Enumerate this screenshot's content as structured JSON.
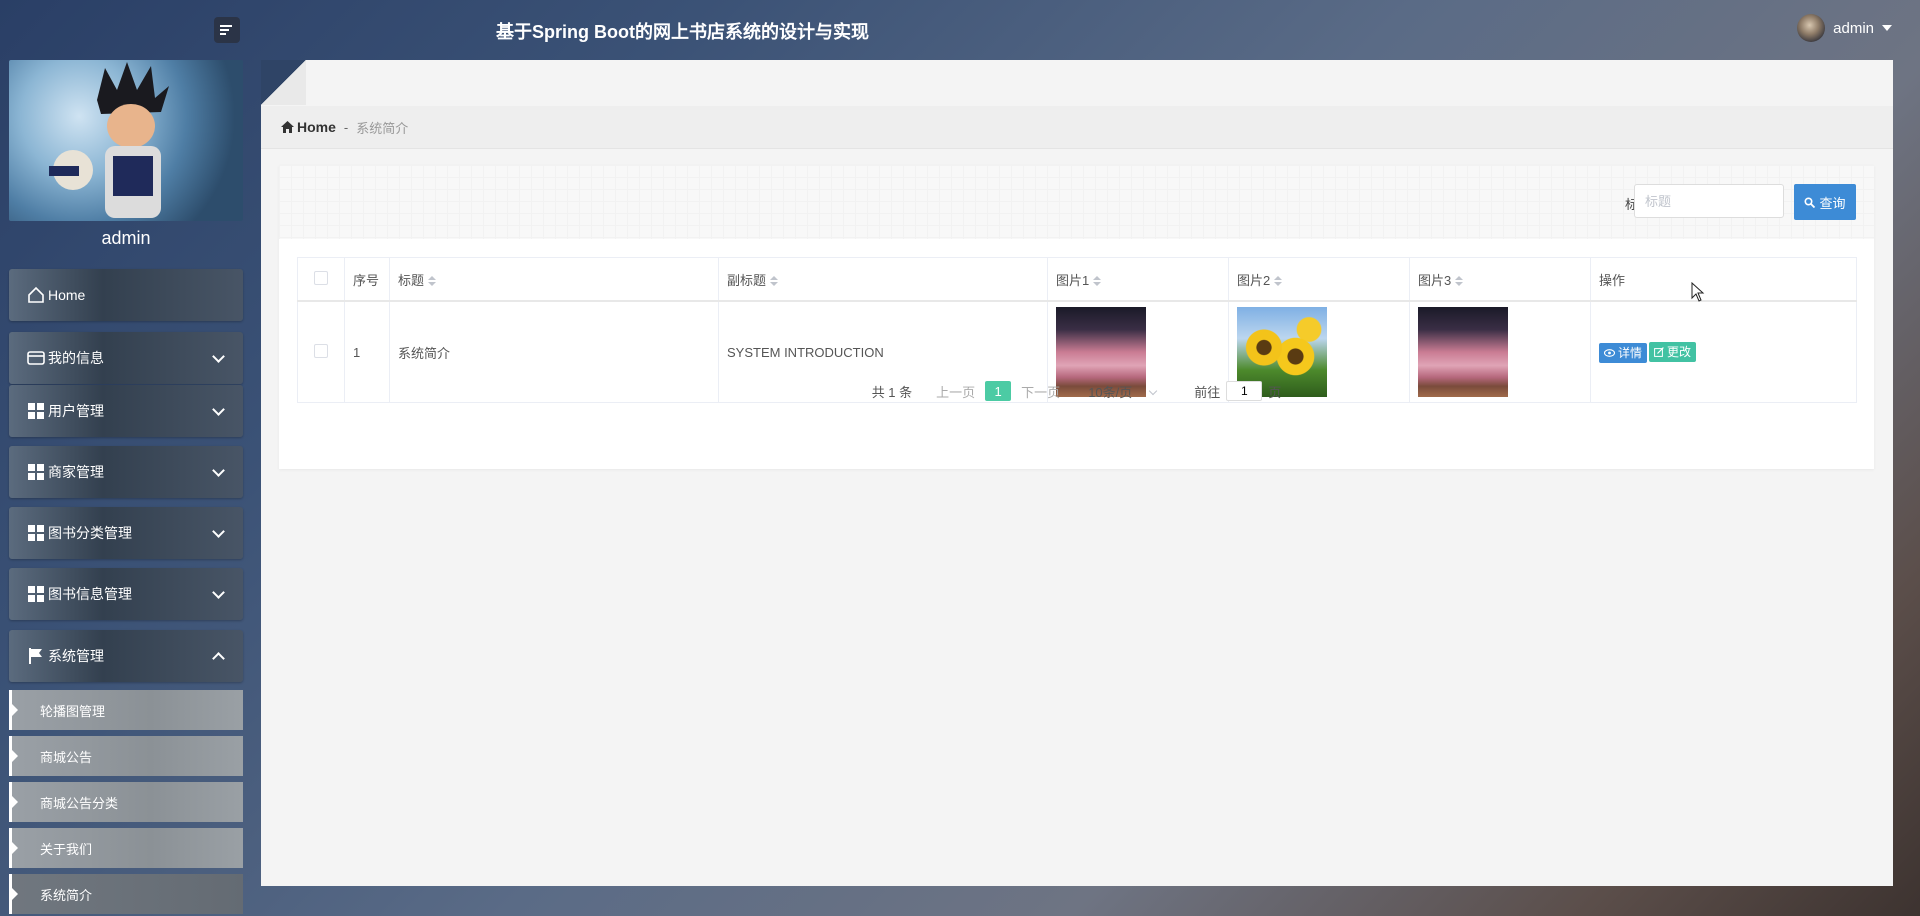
{
  "header": {
    "title": "基于Spring Boot的网上书店系统的设计与实现",
    "username": "admin"
  },
  "sidebar": {
    "profile_name": "admin",
    "items": [
      {
        "label": "Home",
        "icon": "home-icon"
      },
      {
        "label": "我的信息",
        "icon": "wallet-icon"
      },
      {
        "label": "用户管理",
        "icon": "grid-icon"
      },
      {
        "label": "商家管理",
        "icon": "grid-icon"
      },
      {
        "label": "图书分类管理",
        "icon": "grid-icon"
      },
      {
        "label": "图书信息管理",
        "icon": "grid-icon"
      },
      {
        "label": "系统管理",
        "icon": "flag-icon",
        "expanded": true
      }
    ],
    "subitems": [
      "轮播图管理",
      "商城公告",
      "商城公告分类",
      "关于我们",
      "系统简介"
    ],
    "active_subitem": "系统简介"
  },
  "breadcrumb": {
    "home": "Home",
    "sep": "-",
    "current": "系统简介"
  },
  "search": {
    "label": "标题",
    "placeholder": "标题",
    "button": "查询"
  },
  "table": {
    "columns": [
      "序号",
      "标题",
      "副标题",
      "图片1",
      "图片2",
      "图片3",
      "操作"
    ],
    "rows": [
      {
        "index": "1",
        "title": "系统简介",
        "subtitle": "SYSTEM INTRODUCTION",
        "images": [
          "pink-room",
          "sunflowers",
          "pink-room"
        ]
      }
    ],
    "actions": {
      "detail": "详情",
      "edit": "更改"
    }
  },
  "pagination": {
    "total": "共 1 条",
    "prev": "上一页",
    "current_page": "1",
    "next": "下一页",
    "page_size": "10条/页",
    "goto": "前往",
    "goto_value": "1",
    "page_unit": "页"
  },
  "colors": {
    "primary": "#3d8bd6",
    "success": "#42c2a3",
    "active_page": "#4ccba4"
  }
}
